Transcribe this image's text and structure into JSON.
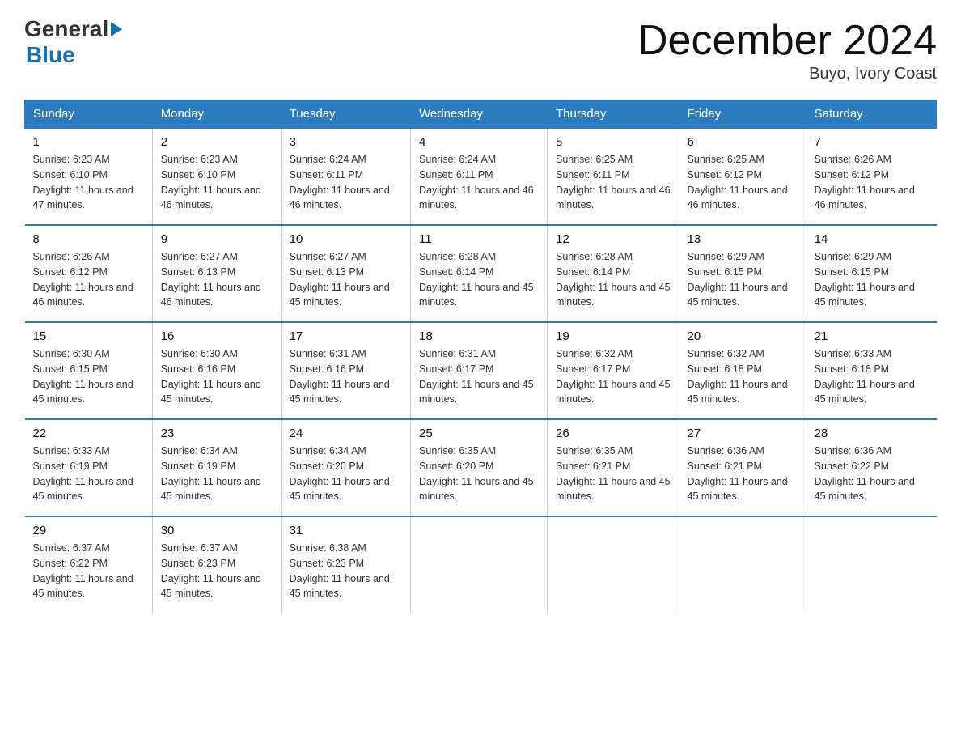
{
  "header": {
    "logo_general": "General",
    "logo_blue": "Blue",
    "month_title": "December 2024",
    "location": "Buyo, Ivory Coast"
  },
  "days_of_week": [
    "Sunday",
    "Monday",
    "Tuesday",
    "Wednesday",
    "Thursday",
    "Friday",
    "Saturday"
  ],
  "weeks": [
    [
      {
        "day": "1",
        "sunrise": "6:23 AM",
        "sunset": "6:10 PM",
        "daylight": "11 hours and 47 minutes."
      },
      {
        "day": "2",
        "sunrise": "6:23 AM",
        "sunset": "6:10 PM",
        "daylight": "11 hours and 46 minutes."
      },
      {
        "day": "3",
        "sunrise": "6:24 AM",
        "sunset": "6:11 PM",
        "daylight": "11 hours and 46 minutes."
      },
      {
        "day": "4",
        "sunrise": "6:24 AM",
        "sunset": "6:11 PM",
        "daylight": "11 hours and 46 minutes."
      },
      {
        "day": "5",
        "sunrise": "6:25 AM",
        "sunset": "6:11 PM",
        "daylight": "11 hours and 46 minutes."
      },
      {
        "day": "6",
        "sunrise": "6:25 AM",
        "sunset": "6:12 PM",
        "daylight": "11 hours and 46 minutes."
      },
      {
        "day": "7",
        "sunrise": "6:26 AM",
        "sunset": "6:12 PM",
        "daylight": "11 hours and 46 minutes."
      }
    ],
    [
      {
        "day": "8",
        "sunrise": "6:26 AM",
        "sunset": "6:12 PM",
        "daylight": "11 hours and 46 minutes."
      },
      {
        "day": "9",
        "sunrise": "6:27 AM",
        "sunset": "6:13 PM",
        "daylight": "11 hours and 46 minutes."
      },
      {
        "day": "10",
        "sunrise": "6:27 AM",
        "sunset": "6:13 PM",
        "daylight": "11 hours and 45 minutes."
      },
      {
        "day": "11",
        "sunrise": "6:28 AM",
        "sunset": "6:14 PM",
        "daylight": "11 hours and 45 minutes."
      },
      {
        "day": "12",
        "sunrise": "6:28 AM",
        "sunset": "6:14 PM",
        "daylight": "11 hours and 45 minutes."
      },
      {
        "day": "13",
        "sunrise": "6:29 AM",
        "sunset": "6:15 PM",
        "daylight": "11 hours and 45 minutes."
      },
      {
        "day": "14",
        "sunrise": "6:29 AM",
        "sunset": "6:15 PM",
        "daylight": "11 hours and 45 minutes."
      }
    ],
    [
      {
        "day": "15",
        "sunrise": "6:30 AM",
        "sunset": "6:15 PM",
        "daylight": "11 hours and 45 minutes."
      },
      {
        "day": "16",
        "sunrise": "6:30 AM",
        "sunset": "6:16 PM",
        "daylight": "11 hours and 45 minutes."
      },
      {
        "day": "17",
        "sunrise": "6:31 AM",
        "sunset": "6:16 PM",
        "daylight": "11 hours and 45 minutes."
      },
      {
        "day": "18",
        "sunrise": "6:31 AM",
        "sunset": "6:17 PM",
        "daylight": "11 hours and 45 minutes."
      },
      {
        "day": "19",
        "sunrise": "6:32 AM",
        "sunset": "6:17 PM",
        "daylight": "11 hours and 45 minutes."
      },
      {
        "day": "20",
        "sunrise": "6:32 AM",
        "sunset": "6:18 PM",
        "daylight": "11 hours and 45 minutes."
      },
      {
        "day": "21",
        "sunrise": "6:33 AM",
        "sunset": "6:18 PM",
        "daylight": "11 hours and 45 minutes."
      }
    ],
    [
      {
        "day": "22",
        "sunrise": "6:33 AM",
        "sunset": "6:19 PM",
        "daylight": "11 hours and 45 minutes."
      },
      {
        "day": "23",
        "sunrise": "6:34 AM",
        "sunset": "6:19 PM",
        "daylight": "11 hours and 45 minutes."
      },
      {
        "day": "24",
        "sunrise": "6:34 AM",
        "sunset": "6:20 PM",
        "daylight": "11 hours and 45 minutes."
      },
      {
        "day": "25",
        "sunrise": "6:35 AM",
        "sunset": "6:20 PM",
        "daylight": "11 hours and 45 minutes."
      },
      {
        "day": "26",
        "sunrise": "6:35 AM",
        "sunset": "6:21 PM",
        "daylight": "11 hours and 45 minutes."
      },
      {
        "day": "27",
        "sunrise": "6:36 AM",
        "sunset": "6:21 PM",
        "daylight": "11 hours and 45 minutes."
      },
      {
        "day": "28",
        "sunrise": "6:36 AM",
        "sunset": "6:22 PM",
        "daylight": "11 hours and 45 minutes."
      }
    ],
    [
      {
        "day": "29",
        "sunrise": "6:37 AM",
        "sunset": "6:22 PM",
        "daylight": "11 hours and 45 minutes."
      },
      {
        "day": "30",
        "sunrise": "6:37 AM",
        "sunset": "6:23 PM",
        "daylight": "11 hours and 45 minutes."
      },
      {
        "day": "31",
        "sunrise": "6:38 AM",
        "sunset": "6:23 PM",
        "daylight": "11 hours and 45 minutes."
      },
      {
        "day": "",
        "sunrise": "",
        "sunset": "",
        "daylight": ""
      },
      {
        "day": "",
        "sunrise": "",
        "sunset": "",
        "daylight": ""
      },
      {
        "day": "",
        "sunrise": "",
        "sunset": "",
        "daylight": ""
      },
      {
        "day": "",
        "sunrise": "",
        "sunset": "",
        "daylight": ""
      }
    ]
  ]
}
